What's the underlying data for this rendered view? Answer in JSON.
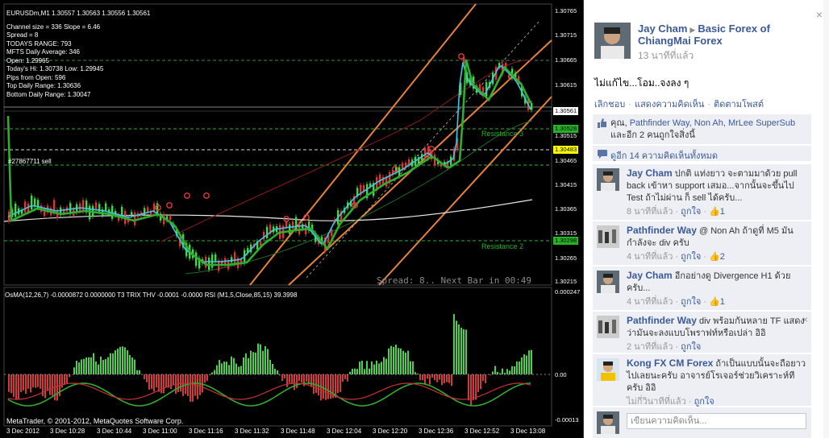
{
  "chart": {
    "symbol_line": "EURUSDm,M1  1.30557 1.30563 1.30556 1.30561",
    "info_lines": [
      "Channel size = 336 Slope = 6.46",
      "Spread = 8",
      "TODAYS RANGE: 793",
      "MFTS Daily Average: 346",
      "Open: 1.29965",
      "Today's Hi: 1.30738  Low: 1.29945",
      "Pips from Open: 596",
      "Top Daily Range: 1.30636",
      "Bottom Daily Range: 1.30047"
    ],
    "order_label": "#27867711 sell",
    "spread_overlay": "Spread: 8.. Next Bar in 00:49",
    "resistance_3": "Resistance 3",
    "resistance_2": "Resistance 2",
    "price_ticks": [
      "1.30765",
      "1.30715",
      "1.30665",
      "1.30615",
      "1.30565",
      "1.30515",
      "1.30465",
      "1.30415",
      "1.30365",
      "1.30315",
      "1.30265",
      "1.30215"
    ],
    "price_boxes": {
      "current": "1.30561",
      "green": "1.30528",
      "yellow": "1.30483",
      "green_low": "1.30298"
    },
    "osma_header": "OsMA(12,26,7) -0.0000872 0.0000000   T3 TRIX THV -0.0001 -0.0000   RSI (M1,5,Close,85,15) 39.3998",
    "osma_ticks": [
      "0.000247",
      "0.00",
      "-0.00013"
    ],
    "time_ticks": [
      "3 Dec 2012",
      "3 Dec 10:28",
      "3 Dec 10:44",
      "3 Dec 11:00",
      "3 Dec 11:16",
      "3 Dec 11:32",
      "3 Dec 11:48",
      "3 Dec 12:04",
      "3 Dec 12:20",
      "3 Dec 12:36",
      "3 Dec 12:52",
      "3 Dec 13:08"
    ],
    "copyright": "MetaTrader, © 2001-2012, MetaQuotes Software Corp.",
    "colors": {
      "background": "#000000",
      "channel": "#e8823a",
      "support_line": "#2bb02b",
      "bull": "#4cd14c",
      "bear": "#d23a3a",
      "price_axis_current": "#ffffff",
      "price_axis_yellow": "#ffff00"
    }
  },
  "fb": {
    "close_icon": "×",
    "post": {
      "author": "Jay Cham",
      "arrow": "▶",
      "group": "Basic Forex of ChiangMai Forex",
      "time": "13 นาทีที่แล้ว",
      "text": "ไม่แก้ไข...โอม..จงลง ๆ",
      "actions": {
        "unlike": "เลิกชอบ",
        "comment": "แสดงความคิดเห็น",
        "follow": "ติดตามโพสต์"
      }
    },
    "likes": {
      "prefix": "คุณ, ",
      "names": "Pathfinder Way, Non Ah, MrLee SuperSub",
      "suffix": " และอีก 2 คนถูกใจสิ่งนี้",
      "suffix_link": "และอีก 2 คน",
      "suffix_tail": "ถูกใจสิ่งนี้"
    },
    "view_all": "ดูอีก 14 ความคิดเห็นทั้งหมด",
    "comments": [
      {
        "name": "Jay Cham",
        "text": "ปกติ แท่งยาว จะตามมาด้วย pull back เข้าหา support เสมอ...จากนั้นจะขึ้นไป Test ถ้าไม่ผ่าน ก็ sell ได้ครับ...",
        "time": "8 นาทีที่แล้ว",
        "like": "ถูกใจ",
        "count": "1"
      },
      {
        "name": "Pathfinder Way",
        "text": "@ Non Ah ถ้าดูที่ M5 มันกำลังจะ div ครับ",
        "mention": "Non Ah",
        "time": "4 นาทีที่แล้ว",
        "like": "ถูกใจ",
        "count": "2"
      },
      {
        "name": "Jay Cham",
        "text": "อีกอย่างดู Divergence H1 ด้วยครับ...",
        "time": "4 นาทีที่แล้ว",
        "like": "ถูกใจ",
        "count": "1"
      },
      {
        "name": "Pathfinder Way",
        "text": "div พร้อมกันหลาย TF แสดงว่ามันจะลงแบบโพราฟท์หรือเปล่า อิอิ",
        "time": "2 นาทีที่แล้ว",
        "like": "ถูกใจ",
        "count": ""
      },
      {
        "name": "Kong FX CM Forex",
        "text": "ถ้าเป็นแบบนั้นจะถือยาวไปเลยนะครับ อาจารย์โรเจอร์ช่วยวิเคราะห์ทีครับ อิอิ",
        "time": "ไม่กี่วินาทีที่แล้ว",
        "like": "ถูกใจ",
        "count": ""
      }
    ],
    "write_placeholder": "เขียนความคิดเห็น...",
    "colors": {
      "link": "#3b5998",
      "box": "#edeff4",
      "muted": "#999999"
    }
  }
}
